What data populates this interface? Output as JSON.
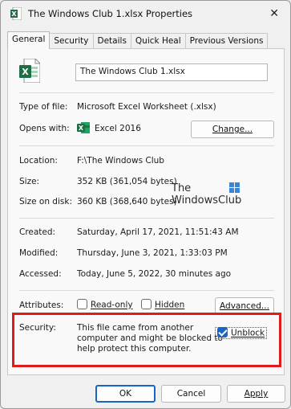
{
  "window": {
    "title": "The Windows Club 1.xlsx Properties",
    "close_glyph": "✕"
  },
  "tabs": [
    {
      "label": "General",
      "active": true
    },
    {
      "label": "Security",
      "active": false
    },
    {
      "label": "Details",
      "active": false
    },
    {
      "label": "Quick Heal",
      "active": false
    },
    {
      "label": "Previous Versions",
      "active": false
    }
  ],
  "general": {
    "file_name": "The Windows Club 1.xlsx",
    "type_of_file_label": "Type of file:",
    "type_of_file_value": "Microsoft Excel Worksheet (.xlsx)",
    "opens_with_label": "Opens with:",
    "opens_with_value": "Excel 2016",
    "change_button": "Change...",
    "location_label": "Location:",
    "location_value": "F:\\The Windows Club",
    "size_label": "Size:",
    "size_value": "352 KB (361,054 bytes)",
    "size_on_disk_label": "Size on disk:",
    "size_on_disk_value": "360 KB (368,640 bytes)",
    "created_label": "Created:",
    "created_value": "Saturday, April 17, 2021, 11:51:43 AM",
    "modified_label": "Modified:",
    "modified_value": "Thursday, June 3, 2021, 1:33:03 PM",
    "accessed_label": "Accessed:",
    "accessed_value": "Today, June 5, 2022, 30 minutes ago",
    "attributes_label": "Attributes:",
    "readonly_label": "Read-only",
    "readonly_checked": false,
    "hidden_label": "Hidden",
    "hidden_checked": false,
    "advanced_button": "Advanced...",
    "security_label": "Security:",
    "security_line1": "This file came from another",
    "security_line2": "computer and might be blocked to",
    "security_line3": "help protect this computer.",
    "unblock_label": "Unblock",
    "unblock_checked": true
  },
  "watermark": {
    "line1": "The",
    "line2": "WindowsClub"
  },
  "footer": {
    "ok": "OK",
    "cancel": "Cancel",
    "apply": "Apply"
  },
  "colors": {
    "excel_green": "#1d7044",
    "highlight_red": "#e01b1b",
    "check_blue": "#1a64c8"
  },
  "icons": {
    "title_icon": "excel-file-icon",
    "file_icon": "excel-file-icon",
    "opens_with_icon": "excel-app-icon",
    "watermark_icon": "windowsclub-logo-icon"
  }
}
